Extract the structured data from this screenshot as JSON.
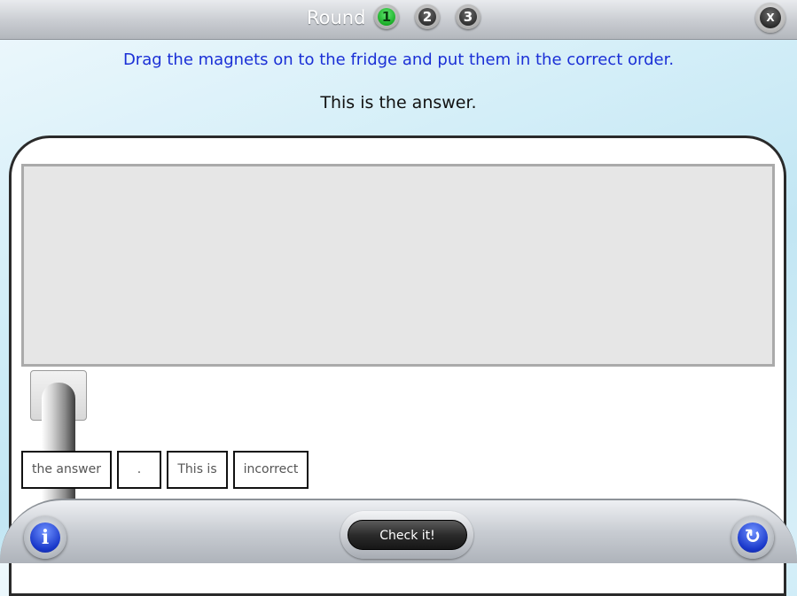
{
  "header": {
    "round_label": "Round",
    "rounds": [
      {
        "label": "1",
        "active": true
      },
      {
        "label": "2",
        "active": false
      },
      {
        "label": "3",
        "active": false
      }
    ],
    "close_label": "X"
  },
  "instruction": "Drag the magnets on to the fridge and put them in the correct order.",
  "answer_text": "This is the answer.",
  "magnets": [
    "the answer",
    ".",
    "This is",
    "incorrect"
  ],
  "footer": {
    "info_label": "i",
    "check_label": "Check it!",
    "reset_label": "↻"
  },
  "colors": {
    "instruction": "#1a2fd6",
    "active_round": "#13a51f",
    "icon_blue": "#1937c9"
  }
}
